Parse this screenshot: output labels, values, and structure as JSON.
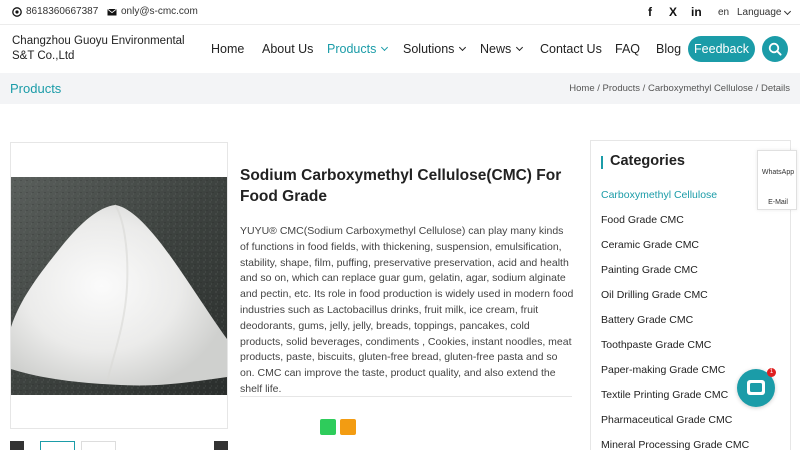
{
  "topbar": {
    "phone": "8618360667387",
    "email": "only@s-cmc.com",
    "social": [
      {
        "name": "facebook-icon",
        "glyph": "f"
      },
      {
        "name": "x-icon",
        "glyph": "X"
      },
      {
        "name": "linkedin-icon",
        "glyph": "in"
      }
    ],
    "lang_code": "en",
    "lang_label": "Language"
  },
  "header": {
    "company": "Changzhou Guoyu Environmental S&T Co.,Ltd",
    "nav": [
      {
        "label": "Home",
        "dropdown": false,
        "active": false
      },
      {
        "label": "About Us",
        "dropdown": false,
        "active": false
      },
      {
        "label": "Products",
        "dropdown": true,
        "active": true
      },
      {
        "label": "Solutions",
        "dropdown": true,
        "active": false
      },
      {
        "label": "News",
        "dropdown": true,
        "active": false
      },
      {
        "label": "Contact Us",
        "dropdown": false,
        "active": false
      },
      {
        "label": "FAQ",
        "dropdown": false,
        "active": false
      },
      {
        "label": "Blog",
        "dropdown": false,
        "active": false
      }
    ],
    "feedback_label": "Feedback"
  },
  "band": {
    "title": "Products",
    "breadcrumb": [
      "Home",
      "Products",
      "Carboxymethyl Cellulose",
      "Details"
    ]
  },
  "product": {
    "title": "Sodium Carboxymethyl Cellulose(CMC) For Food Grade",
    "description": "YUYU® CMC(Sodium Carboxymethyl Cellulose) can play many kinds of functions in food fields, with thickening, suspension, emulsification, stability, shape, film, puffing, preservative preservation, acid and health and so on, which can replace guar gum, gelatin, agar, sodium alginate and pectin, etc. Its role in food production is widely used in modern food industries such as Lactobacillus drinks, fruit milk, ice cream, fruit deodorants, gums, jelly, jelly, breads, toppings, pancakes, cold products, solid beverages, condiments , Cookies, instant noodles, meat products, paste, biscuits, gluten-free bread, gluten-free pasta and so on. CMC can improve the taste, product quality, and also extend the shelf life.",
    "share_colors": [
      "#2ecc5b",
      "#f39c12"
    ]
  },
  "categories": {
    "title": "Categories",
    "items": [
      {
        "label": "Carboxymethyl Cellulose",
        "active": true
      },
      {
        "label": "Food Grade CMC",
        "active": false
      },
      {
        "label": "Ceramic Grade CMC",
        "active": false
      },
      {
        "label": "Painting Grade CMC",
        "active": false
      },
      {
        "label": "Oil Drilling Grade CMC",
        "active": false
      },
      {
        "label": "Battery Grade CMC",
        "active": false
      },
      {
        "label": "Toothpaste Grade CMC",
        "active": false
      },
      {
        "label": "Paper-making Grade CMC",
        "active": false
      },
      {
        "label": "Textile Printing Grade CMC",
        "active": false
      },
      {
        "label": "Pharmaceutical Grade CMC",
        "active": false
      },
      {
        "label": "Mineral Processing Grade CMC",
        "active": false
      }
    ]
  },
  "side_widget": {
    "whatsapp": "WhatsApp",
    "email": "E-Mail"
  },
  "chat": {
    "badge": "1"
  },
  "colors": {
    "accent": "#1b9ca8",
    "band_bg": "#f3f4f6"
  }
}
